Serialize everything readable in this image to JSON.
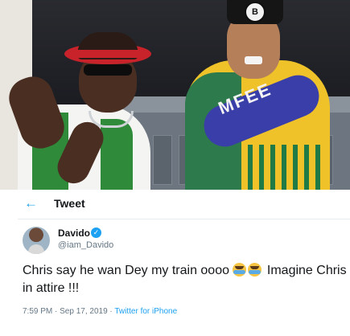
{
  "photo": {
    "sleeve_text": "MFEE",
    "cap_logo": "B"
  },
  "tweet": {
    "header_title": "Tweet",
    "back_icon": "arrow-left-icon",
    "author": {
      "name": "Davido",
      "handle": "@iam_Davido",
      "verified_icon": "verified-badge-icon"
    },
    "text_part1": "Chris say he wan Dey my train oooo ",
    "emoji": "face-with-tears-of-joy",
    "text_part2": " Imagine Chris in attire !!!",
    "timestamp": "7:59 PM · Sep 17, 2019 · ",
    "client": "Twitter for iPhone"
  },
  "colors": {
    "accent": "#1da1f2",
    "text": "#14171a",
    "secondary_text": "#657786"
  }
}
